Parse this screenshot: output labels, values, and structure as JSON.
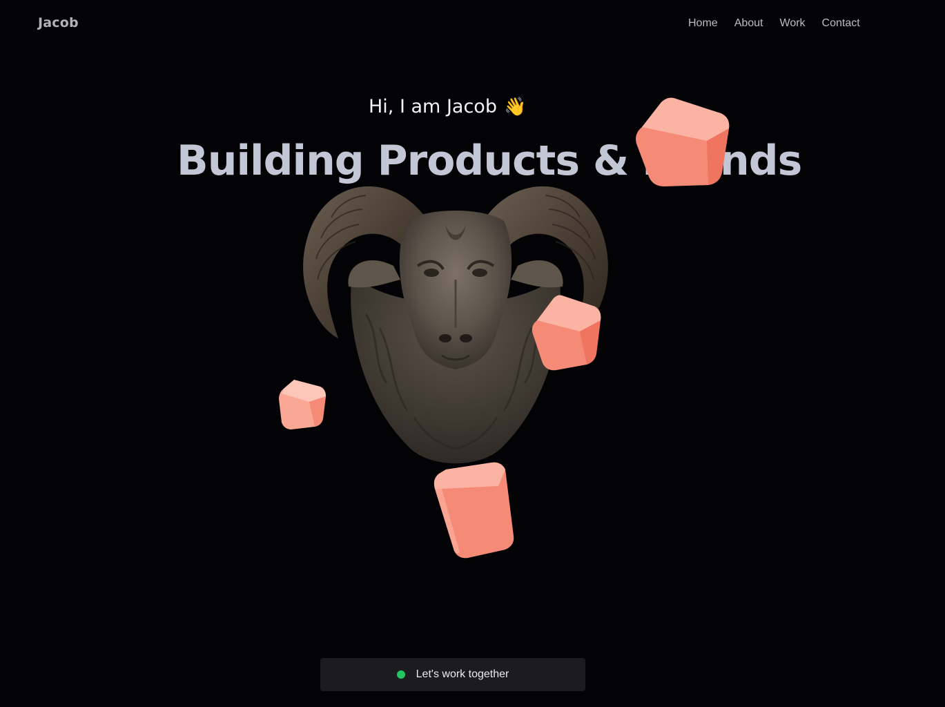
{
  "header": {
    "brand": "Jacob",
    "nav": [
      "Home",
      "About",
      "Work",
      "Contact"
    ]
  },
  "hero": {
    "greeting": "Hi, I am Jacob",
    "wave_emoji": "👋",
    "headline": "Building Products & Brands"
  },
  "cta": {
    "label": "Let's work together",
    "status_color": "#22c55e"
  },
  "colors": {
    "background": "#030305",
    "cube": "#f7806a",
    "headline": "#c3c6d4"
  }
}
